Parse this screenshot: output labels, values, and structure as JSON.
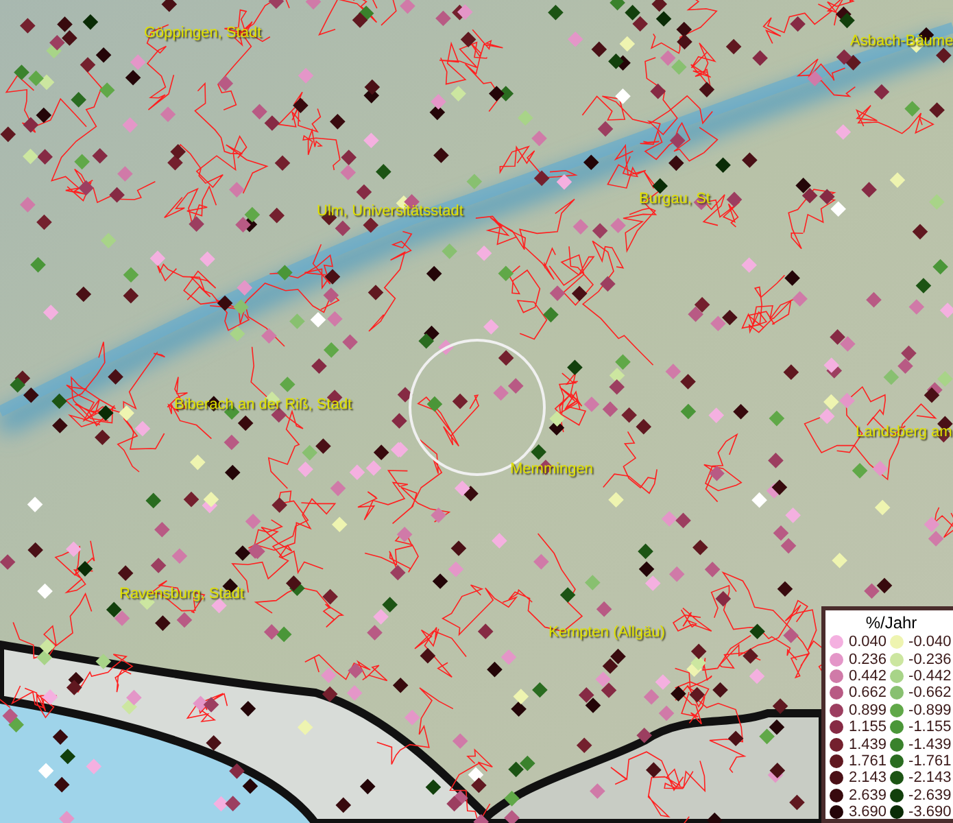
{
  "map": {
    "places": [
      {
        "name": "Göppingen, Stadt"
      },
      {
        "name": "Asbach-Bäume"
      },
      {
        "name": "Ulm, Universitätsstadt"
      },
      {
        "name": "Burgau, St"
      },
      {
        "name": "Biberach an der Riß, Stadt"
      },
      {
        "name": "Memmingen"
      },
      {
        "name": "Landsberg am"
      },
      {
        "name": "Ravensburg, Stadt"
      },
      {
        "name": "Kempten (Allgäu)"
      }
    ]
  },
  "legend": {
    "title": "%/Jahr",
    "columns": [
      [
        {
          "value": "0.040",
          "color": "#f4b0e0"
        },
        {
          "value": "0.236",
          "color": "#e496c8"
        },
        {
          "value": "0.442",
          "color": "#d07aa8"
        },
        {
          "value": "0.662",
          "color": "#b85a84"
        },
        {
          "value": "0.899",
          "color": "#9c3e60"
        },
        {
          "value": "1.155",
          "color": "#862a44"
        },
        {
          "value": "1.439",
          "color": "#74202e"
        },
        {
          "value": "1.761",
          "color": "#601820"
        },
        {
          "value": "2.143",
          "color": "#4a1016"
        },
        {
          "value": "2.639",
          "color": "#380a0e"
        },
        {
          "value": "3.690",
          "color": "#240508"
        }
      ],
      [
        {
          "value": "-0.040",
          "color": "#eef4b0"
        },
        {
          "value": "-0.236",
          "color": "#cce6a0"
        },
        {
          "value": "-0.442",
          "color": "#a8d488"
        },
        {
          "value": "-0.662",
          "color": "#88c070"
        },
        {
          "value": "-0.899",
          "color": "#60a848"
        },
        {
          "value": "-1.155",
          "color": "#4a9638"
        },
        {
          "value": "-1.439",
          "color": "#3a822c"
        },
        {
          "value": "-1.761",
          "color": "#2a6c20"
        },
        {
          "value": "-2.143",
          "color": "#1c5414"
        },
        {
          "value": "-2.639",
          "color": "#12400c"
        },
        {
          "value": "-3.690",
          "color": "#0a2c06"
        }
      ]
    ]
  }
}
